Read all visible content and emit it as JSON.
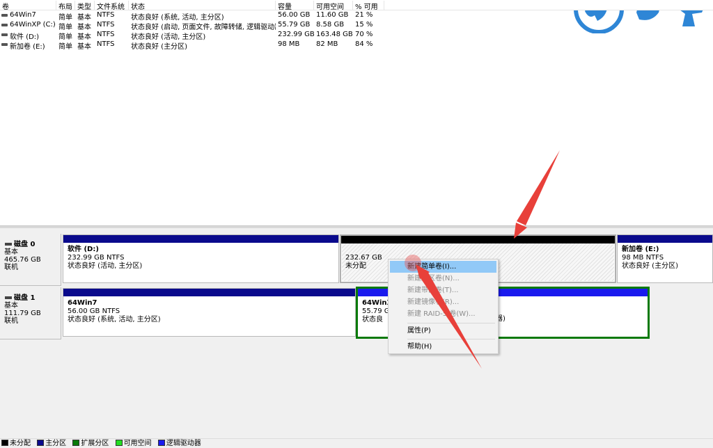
{
  "volume_table": {
    "columns": [
      "卷",
      "布局",
      "类型",
      "文件系统",
      "状态",
      "容量",
      "可用空间",
      "% 可用"
    ],
    "rows": [
      {
        "name": "64Win7",
        "layout": "简单",
        "type": "基本",
        "fs": "NTFS",
        "status": "状态良好 (系统, 活动, 主分区)",
        "capacity": "56.00 GB",
        "free": "11.60 GB",
        "pct": "21 %"
      },
      {
        "name": "64WinXP  (C:)",
        "layout": "简单",
        "type": "基本",
        "fs": "NTFS",
        "status": "状态良好 (启动, 页面文件, 故障转储, 逻辑驱动器)",
        "capacity": "55.79 GB",
        "free": "8.58 GB",
        "pct": "15 %"
      },
      {
        "name": "软件 (D:)",
        "layout": "简单",
        "type": "基本",
        "fs": "NTFS",
        "status": "状态良好 (活动, 主分区)",
        "capacity": "232.99 GB",
        "free": "163.48 GB",
        "pct": "70 %"
      },
      {
        "name": "新加卷 (E:)",
        "layout": "简单",
        "type": "基本",
        "fs": "NTFS",
        "status": "状态良好 (主分区)",
        "capacity": "98 MB",
        "free": "82 MB",
        "pct": "84 %"
      }
    ]
  },
  "disks": [
    {
      "title": "磁盘 0",
      "type": "基本",
      "size": "465.76 GB",
      "state": "联机",
      "partitions": [
        {
          "name": "软件  (D:)",
          "size": "232.99 GB NTFS",
          "status": "状态良好 (活动, 主分区)"
        },
        {
          "name": "",
          "size": "232.67 GB",
          "status": "未分配"
        },
        {
          "name": "新加卷  (E:)",
          "size": "98 MB NTFS",
          "status": "状态良好 (主分区)"
        }
      ]
    },
    {
      "title": "磁盘 1",
      "type": "基本",
      "size": "111.79 GB",
      "state": "联机",
      "partitions": [
        {
          "name": "64Win7",
          "size": "56.00 GB NTFS",
          "status": "状态良好 (系统, 活动, 主分区)"
        },
        {
          "name": "64WinX",
          "size": "55.79 GI",
          "status": "状态良",
          "status_tail": "器)"
        }
      ]
    }
  ],
  "context_menu": {
    "items": [
      {
        "label": "新建简单卷(I)...",
        "enabled": true,
        "highlighted": true
      },
      {
        "label": "新建跨区卷(N)...",
        "enabled": false
      },
      {
        "label": "新建带区卷(T)...",
        "enabled": false
      },
      {
        "label": "新建镜像卷(R)...",
        "enabled": false
      },
      {
        "label": "新建 RAID-5 卷(W)...",
        "enabled": false
      },
      {
        "label": "属性(P)",
        "enabled": true
      },
      {
        "label": "帮助(H)",
        "enabled": true
      }
    ]
  },
  "legend": [
    {
      "label": "未分配",
      "color": "#000000"
    },
    {
      "label": "主分区",
      "color": "#0a0a8c"
    },
    {
      "label": "扩展分区",
      "color": "#087a08"
    },
    {
      "label": "可用空间",
      "color": "#22dd22"
    },
    {
      "label": "逻辑驱动器",
      "color": "#1a1aee"
    }
  ],
  "colors": {
    "primary": "#0a0a8c",
    "unallocated": "#000000",
    "logical": "#1a1aee",
    "extended": "#087a08",
    "menu_highlight": "#91c9f7",
    "annotation_arrow": "#e8403a",
    "logo_blue": "#2e86d6"
  },
  "icons": [
    "drive-icon",
    "disk-icon",
    "red-arrow-annotation",
    "logo-horse-icon"
  ]
}
